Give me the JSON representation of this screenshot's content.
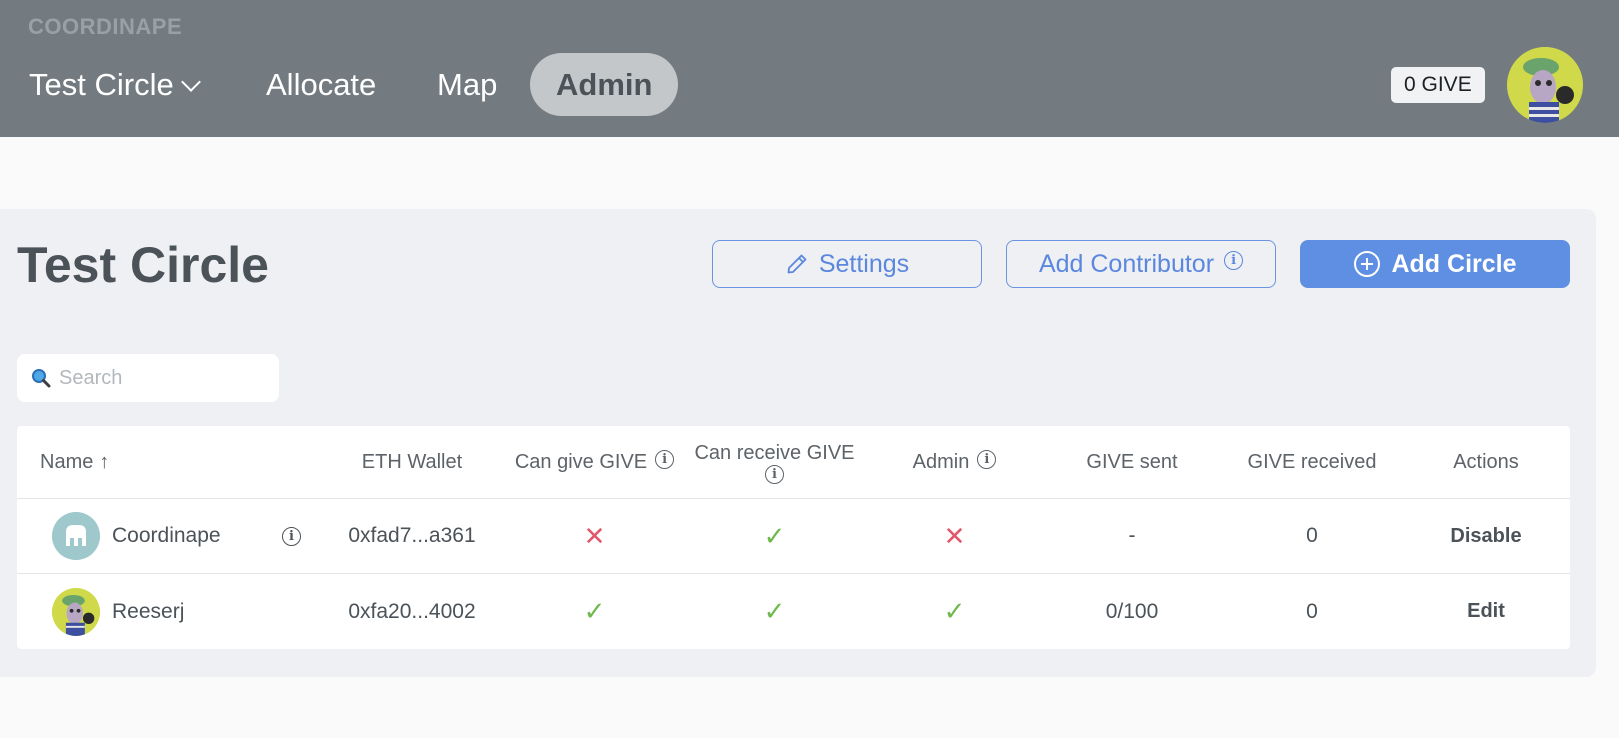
{
  "header": {
    "brand": "COORDINAPE",
    "circle_selector": "Test Circle",
    "nav": {
      "allocate": "Allocate",
      "map": "Map",
      "admin": "Admin"
    },
    "give_balance": "0 GIVE"
  },
  "page": {
    "title": "Test Circle",
    "buttons": {
      "settings": "Settings",
      "add_contributor": "Add Contributor",
      "add_circle": "Add Circle"
    },
    "search_placeholder": "Search"
  },
  "table": {
    "columns": {
      "name": "Name",
      "name_sort": "↑",
      "wallet": "ETH Wallet",
      "can_give": "Can give GIVE",
      "can_receive": "Can receive GIVE",
      "admin": "Admin",
      "give_sent": "GIVE sent",
      "give_received": "GIVE received",
      "actions": "Actions"
    },
    "rows": [
      {
        "name": "Coordinape",
        "wallet": "0xfad7...a361",
        "can_give": false,
        "can_receive": true,
        "admin": false,
        "give_sent": "-",
        "give_received": "0",
        "action": "Disable"
      },
      {
        "name": "Reeserj",
        "wallet": "0xfa20...4002",
        "can_give": true,
        "can_receive": true,
        "admin": true,
        "give_sent": "0/100",
        "give_received": "0",
        "action": "Edit"
      }
    ]
  },
  "symbols": {
    "check": "✓",
    "cross": "✕",
    "info": "i"
  },
  "colors": {
    "header_bg": "#737b80",
    "primary": "#5e8fe3",
    "check": "#6fb84c",
    "cross": "#e0566a",
    "panel_bg": "#eef0f3"
  }
}
